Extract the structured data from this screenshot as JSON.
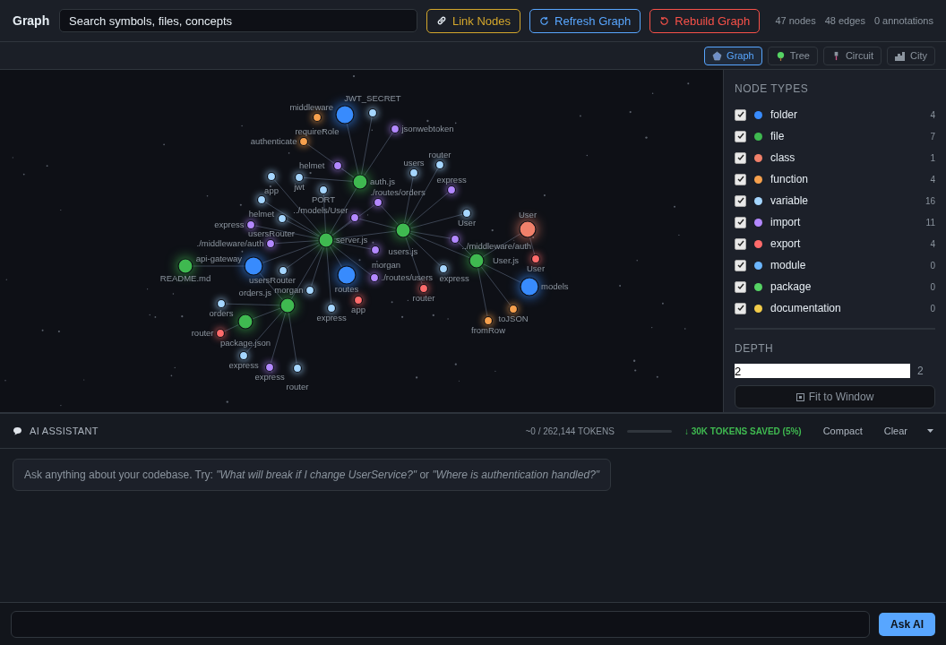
{
  "header": {
    "title": "Graph",
    "search": {
      "placeholder": "Search symbols, files, concepts"
    },
    "buttons": [
      {
        "label": "Link Nodes",
        "kind": "link"
      },
      {
        "label": "Refresh Graph",
        "kind": "refresh"
      },
      {
        "label": "Rebuild Graph",
        "kind": "rebuild"
      }
    ],
    "stats": [
      "47 nodes",
      "48 edges",
      "0 annotations"
    ]
  },
  "view_tabs": [
    {
      "label": "Graph",
      "kind": "graph",
      "selected": true
    },
    {
      "label": "Tree",
      "kind": "tree",
      "selected": false
    },
    {
      "label": "Circuit",
      "kind": "circuit",
      "selected": false
    },
    {
      "label": "City",
      "kind": "city",
      "selected": false
    }
  ],
  "graph": {
    "nodes": [
      {
        "label": "JWT_SECRET",
        "color": "#a5d6ff"
      },
      {
        "label": "middleware",
        "color": "#388bfd"
      },
      {
        "label": "requireRole",
        "color": "#f6a04d"
      },
      {
        "label": "jsonwebtoken",
        "color": "#b388ff"
      },
      {
        "label": "authenticate",
        "color": "#f6a04d"
      },
      {
        "label": "helmet",
        "color": "#b388ff"
      },
      {
        "label": "auth.js",
        "color": "#3fb950"
      },
      {
        "label": "app",
        "color": "#a5d6ff"
      },
      {
        "label": "jwt",
        "color": "#a5d6ff"
      },
      {
        "label": "PORT",
        "color": "#a5d6ff"
      },
      {
        "label": "users",
        "color": "#a5d6ff"
      },
      {
        "label": "router",
        "color": "#a5d6ff"
      },
      {
        "label": "express",
        "color": "#b388ff"
      },
      {
        "label": "User",
        "color": "#a5d6ff"
      },
      {
        "label": "helmet",
        "color": "#a5d6ff"
      },
      {
        "label": "./routes/orders",
        "color": "#b388ff"
      },
      {
        "label": "usersRouter",
        "color": "#a5d6ff"
      },
      {
        "label": "../models/User",
        "color": "#b388ff"
      },
      {
        "label": "express",
        "color": "#b388ff"
      },
      {
        "label": "users.js",
        "color": "#3fb950"
      },
      {
        "label": "server.js",
        "color": "#3fb950"
      },
      {
        "label": "./middleware/auth",
        "color": "#b388ff"
      },
      {
        "label": "morgan",
        "color": "#b388ff"
      },
      {
        "label": "../middleware/auth",
        "color": "#b388ff"
      },
      {
        "label": "User",
        "color": "#f0806a"
      },
      {
        "label": "README.md",
        "color": "#3fb950"
      },
      {
        "label": "api-gateway",
        "color": "#388bfd"
      },
      {
        "label": "usersRouter",
        "color": "#a5d6ff"
      },
      {
        "label": "routes",
        "color": "#388bfd"
      },
      {
        "label": "./routes/users",
        "color": "#b388ff"
      },
      {
        "label": "express",
        "color": "#a5d6ff"
      },
      {
        "label": "User.js",
        "color": "#3fb950"
      },
      {
        "label": "User",
        "color": "#ff6b6b"
      },
      {
        "label": "router",
        "color": "#ff6b6b"
      },
      {
        "label": "models",
        "color": "#388bfd"
      },
      {
        "label": "morgan",
        "color": "#a5d6ff"
      },
      {
        "label": "app",
        "color": "#ff6b6b"
      },
      {
        "label": "orders.js",
        "color": "#3fb950"
      },
      {
        "label": "express",
        "color": "#a5d6ff"
      },
      {
        "label": "orders",
        "color": "#a5d6ff"
      },
      {
        "label": "package.json",
        "color": "#3fb950"
      },
      {
        "label": "toJSON",
        "color": "#f6a04d"
      },
      {
        "label": "fromRow",
        "color": "#f6a04d"
      },
      {
        "label": "router",
        "color": "#ff6b6b"
      },
      {
        "label": "express",
        "color": "#a5d6ff"
      },
      {
        "label": "express",
        "color": "#b388ff"
      },
      {
        "label": "router",
        "color": "#a5d6ff"
      }
    ]
  },
  "sidebar": {
    "node_types_title": "NODE TYPES",
    "node_types": [
      {
        "label": "folder",
        "color": "#388bfd",
        "count": "4",
        "checked": true
      },
      {
        "label": "file",
        "color": "#3fb950",
        "count": "7",
        "checked": true
      },
      {
        "label": "class",
        "color": "#f0806a",
        "count": "1",
        "checked": true
      },
      {
        "label": "function",
        "color": "#f6a04d",
        "count": "4",
        "checked": true
      },
      {
        "label": "variable",
        "color": "#a5d6ff",
        "count": "16",
        "checked": true
      },
      {
        "label": "import",
        "color": "#b388ff",
        "count": "11",
        "checked": true
      },
      {
        "label": "export",
        "color": "#ff6b6b",
        "count": "4",
        "checked": true
      },
      {
        "label": "module",
        "color": "#6cb6ff",
        "count": "0",
        "checked": true
      },
      {
        "label": "package",
        "color": "#56d364",
        "count": "0",
        "checked": true
      },
      {
        "label": "documentation",
        "color": "#f2cc4a",
        "count": "0",
        "checked": true
      }
    ],
    "depth_title": "DEPTH",
    "depth_value": "2",
    "depth_reading": "2",
    "fit_button": "Fit to Window"
  },
  "assistant": {
    "title": "AI ASSISTANT",
    "tokens": "~0 / 262,144 TOKENS",
    "token_usage": {
      "level": 0
    },
    "saved": "↓ 30K TOKENS SAVED (5%)",
    "actions": [
      "Compact",
      "Clear"
    ],
    "suggestion": "Ask anything about your codebase. Try: *\"What will break if I change UserService?\"* or *\"Where is authentication handled?\"*",
    "ask_button": "Ask AI"
  }
}
